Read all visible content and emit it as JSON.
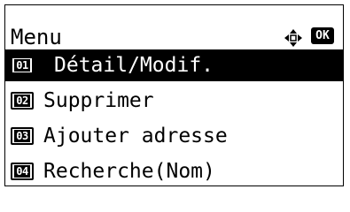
{
  "header": {
    "title": "Menu",
    "nav_icon": "four-way-arrow-icon",
    "ok_label": "OK"
  },
  "menu": {
    "items": [
      {
        "number": "01",
        "label": "Détail/Modif.",
        "selected": true
      },
      {
        "number": "02",
        "label": "Supprimer",
        "selected": false
      },
      {
        "number": "03",
        "label": "Ajouter adresse",
        "selected": false
      },
      {
        "number": "04",
        "label": "Recherche(Nom)",
        "selected": false
      }
    ]
  },
  "colors": {
    "background": "#ffffff",
    "foreground": "#000000",
    "selection": "#000000"
  }
}
